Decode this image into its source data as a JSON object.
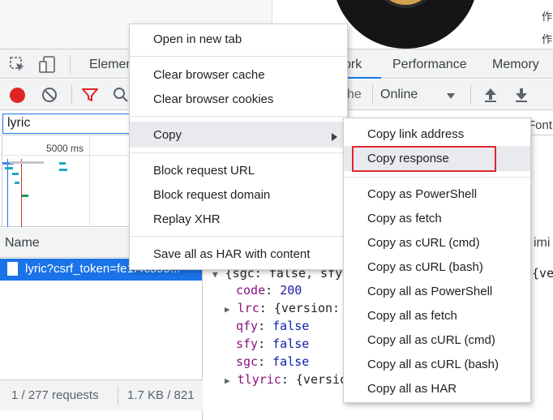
{
  "page": {
    "side_text_1": "作",
    "side_text_2": "作"
  },
  "devtools": {
    "tabs": [
      "Elemen",
      "ork",
      "Performance",
      "Memory"
    ],
    "throttle": "Online",
    "filter_value": "lyric",
    "fragment_he": "he",
    "fragment_font": "Font",
    "timeline_label": "5000 ms",
    "col_name": "Name",
    "col_timing": "imi",
    "selected_row": "lyric?csrf_token=fe1f4c599...",
    "status_requests": "1 / 277 requests",
    "status_size": "1.7 KB / 821",
    "response": {
      "root_line": "{sgc: false, sfy",
      "root_tail": "{ve",
      "code_key": "code",
      "code_val": "200",
      "lrc_key": "lrc",
      "lrc_val": "{version:",
      "qfy_key": "qfy",
      "qfy_val": "false",
      "sfy_key": "sfy",
      "sfy_val": "false",
      "sgc_key": "sgc",
      "sgc_val": "false",
      "tlyric_key": "tlyric",
      "tlyric_val": "{versio"
    }
  },
  "context_menu": {
    "open_new_tab": "Open in new tab",
    "clear_cache": "Clear browser cache",
    "clear_cookies": "Clear browser cookies",
    "copy": "Copy",
    "block_url": "Block request URL",
    "block_domain": "Block request domain",
    "replay_xhr": "Replay XHR",
    "save_har": "Save all as HAR with content"
  },
  "copy_submenu": {
    "link_address": "Copy link address",
    "response": "Copy response",
    "as_powershell": "Copy as PowerShell",
    "as_fetch": "Copy as fetch",
    "as_curl_cmd": "Copy as cURL (cmd)",
    "as_curl_bash": "Copy as cURL (bash)",
    "all_powershell": "Copy all as PowerShell",
    "all_fetch": "Copy all as fetch",
    "all_curl_cmd": "Copy all as cURL (cmd)",
    "all_curl_bash": "Copy all as cURL (bash)",
    "all_har": "Copy all as HAR"
  },
  "colors": {
    "record": "#e02424",
    "selection": "#1a73e8",
    "highlight_box": "#e0282e"
  }
}
